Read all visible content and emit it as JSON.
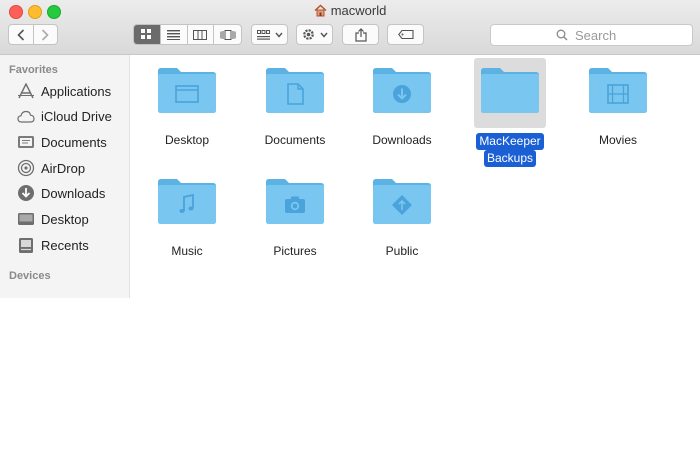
{
  "window": {
    "title": "macworld"
  },
  "toolbar": {
    "back_icon": "chevron-left-icon",
    "forward_icon": "chevron-right-icon",
    "views": [
      "icon-view",
      "list-view",
      "column-view",
      "cover-flow-view"
    ],
    "active_view": "icon-view",
    "search_placeholder": "Search"
  },
  "sidebar": {
    "favorites_heading": "Favorites",
    "favorites": [
      {
        "label": "Applications",
        "icon": "applications-icon"
      },
      {
        "label": "iCloud Drive",
        "icon": "cloud-icon"
      },
      {
        "label": "Documents",
        "icon": "documents-icon"
      },
      {
        "label": "AirDrop",
        "icon": "airdrop-icon"
      },
      {
        "label": "Downloads",
        "icon": "downloads-icon"
      },
      {
        "label": "Desktop",
        "icon": "desktop-icon"
      },
      {
        "label": "Recents",
        "icon": "recents-icon"
      }
    ],
    "devices_heading": "Devices"
  },
  "files": [
    {
      "line1": "Desktop",
      "line2": "",
      "glyph": "desktop",
      "selected": false
    },
    {
      "line1": "Documents",
      "line2": "",
      "glyph": "document",
      "selected": false
    },
    {
      "line1": "Downloads",
      "line2": "",
      "glyph": "download",
      "selected": false
    },
    {
      "line1": "MacKeeper",
      "line2": "Backups",
      "glyph": "none",
      "selected": true
    },
    {
      "line1": "Movies",
      "line2": "",
      "glyph": "film",
      "selected": false
    },
    {
      "line1": "Music",
      "line2": "",
      "glyph": "music",
      "selected": false
    },
    {
      "line1": "Pictures",
      "line2": "",
      "glyph": "camera",
      "selected": false
    },
    {
      "line1": "Public",
      "line2": "",
      "glyph": "public",
      "selected": false
    }
  ],
  "colors": {
    "folder": "#79c6f0",
    "folder_dark": "#5cb2e3",
    "selection": "#1a5fd4"
  }
}
